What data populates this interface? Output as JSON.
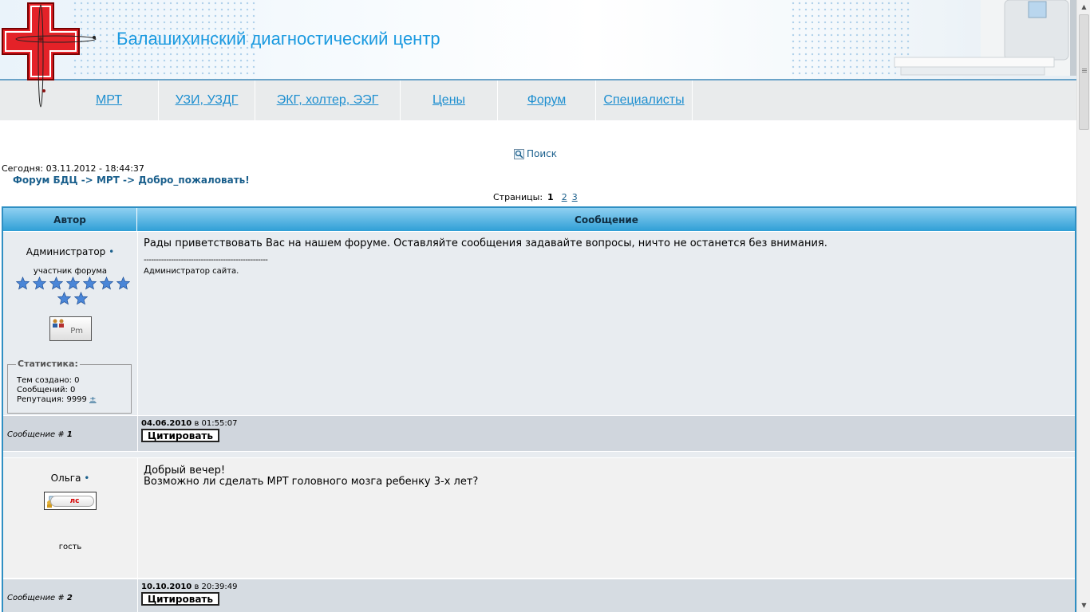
{
  "banner": {
    "title": "Балашихинский диагностический центр",
    "accent_color": "#1b9ae0",
    "logo_icon": "red-cross-logo-icon",
    "decoration_icon": "mri-scanner-icon"
  },
  "nav": {
    "items": [
      {
        "label": "МРТ"
      },
      {
        "label": "УЗИ, УЗДГ"
      },
      {
        "label": "ЭКГ, холтер, ЭЭГ"
      },
      {
        "label": "Цены"
      },
      {
        "label": "Форум"
      },
      {
        "label": "Специалисты"
      }
    ]
  },
  "search": {
    "label": "Поиск",
    "icon": "magnifier-icon"
  },
  "today": "Сегодня: 03.11.2012 - 18:44:37",
  "breadcrumb": {
    "items": [
      "Форум БДЦ",
      "МРТ",
      "Добро_пожаловать!"
    ],
    "separator": "->"
  },
  "pagination": {
    "label": "Страницы:",
    "current": "1",
    "pages": [
      "2",
      "3"
    ]
  },
  "table": {
    "col_author": "Автор",
    "col_message": "Сообщение",
    "header_color": "#2f9fd6"
  },
  "posts": [
    {
      "author": "Администратор",
      "online_marker": "•",
      "rank": "участник форума",
      "stars": 9,
      "pm_label": "Pm",
      "stats": {
        "legend": "Статистика:",
        "topics": "Тем создано: 0",
        "messages": "Сообщений: 0",
        "reputation": "Репутация: 9999",
        "reputation_action": "±"
      },
      "text": "Рады приветствовать Вас на нашем форуме. Оставляйте сообщения задавайте вопросы, ничто не останется без внимания.",
      "divider": "--------------------------------------------------",
      "signature": "Администратор сайта.",
      "date": "04.06.2010",
      "at": "в",
      "time": "01:55:07",
      "quote_label": "Цитировать",
      "post_label": "Сообщение #",
      "post_number": "1"
    },
    {
      "author": "Ольга",
      "online_marker": "•",
      "ls_label": "лс",
      "role": "гость",
      "text_line1": "Добрый вечер!",
      "text_line2": "Возможно ли сделать МРТ головного мозга ребенку 3-х лет?",
      "date": "10.10.2010",
      "at": "в",
      "time": "20:39:49",
      "quote_label": "Цитировать",
      "post_label": "Сообщение #",
      "post_number": "2"
    }
  ]
}
